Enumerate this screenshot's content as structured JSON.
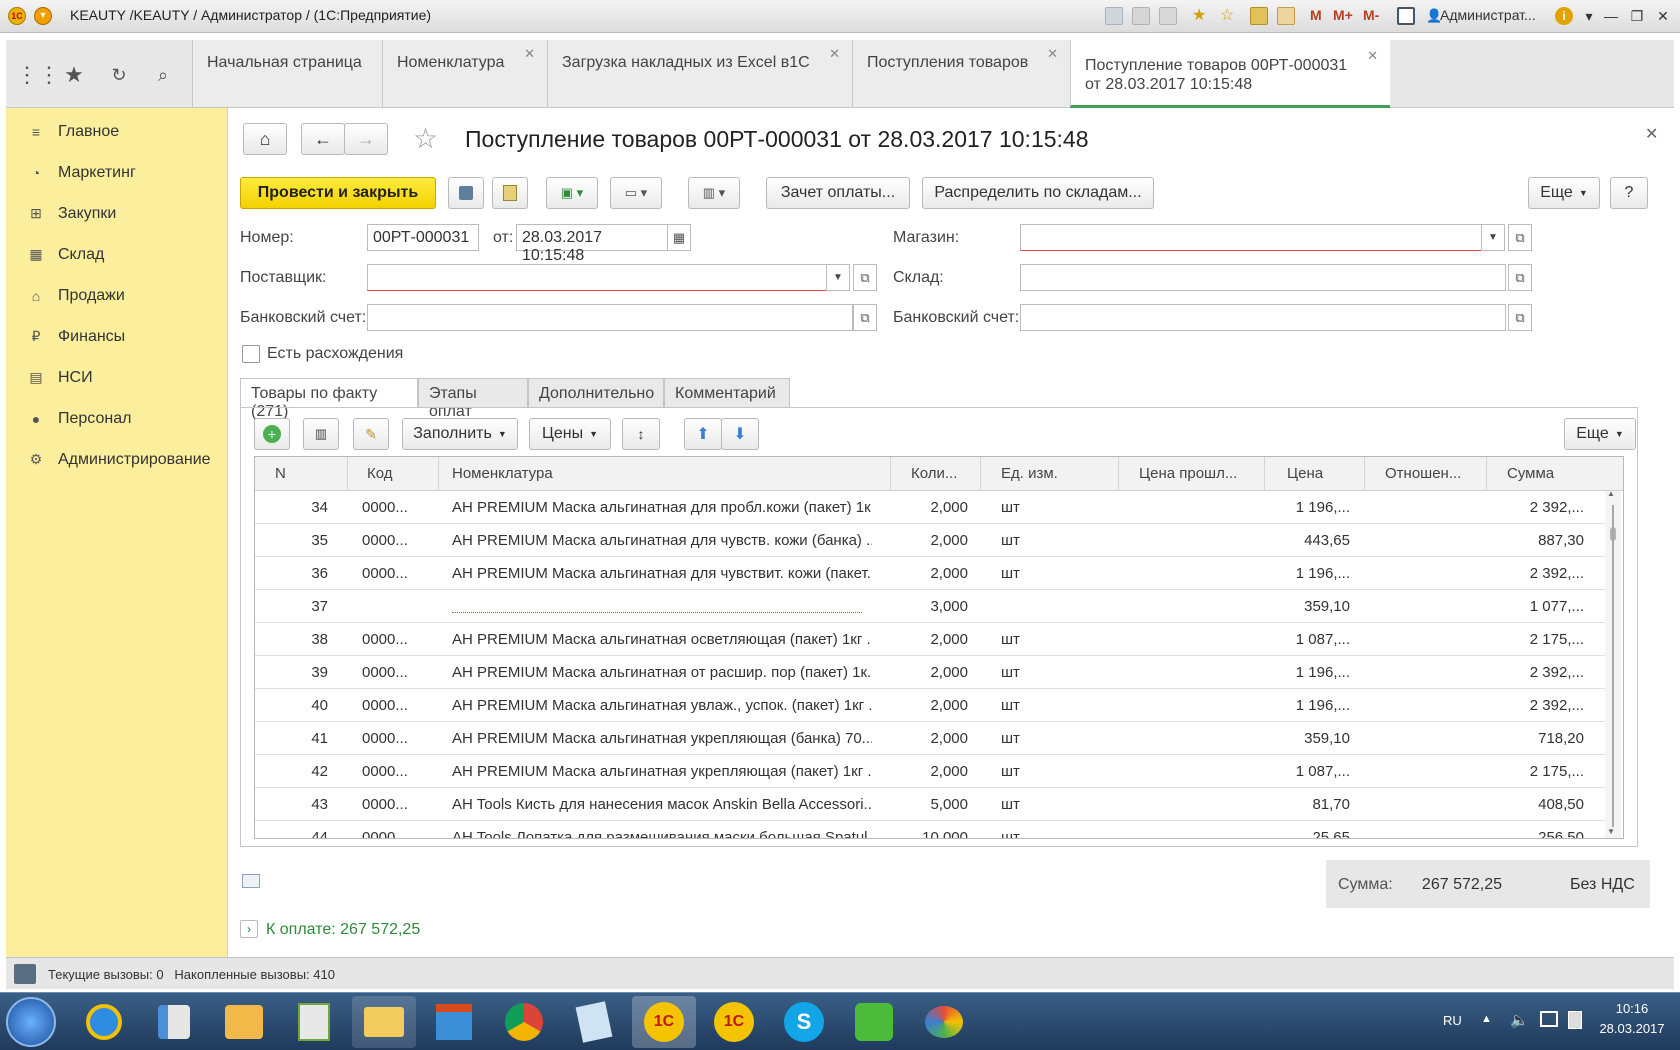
{
  "titlebar": {
    "title": "KEAUTY /KEAUTY / Администратор / (1С:Предприятие)",
    "user": "Администрат...",
    "logo_text": "1С",
    "toolbar_letters": [
      "M",
      "M+",
      "M-"
    ]
  },
  "tabs": [
    {
      "label": "Начальная страница",
      "closable": false
    },
    {
      "label": "Номенклатура",
      "closable": true
    },
    {
      "label": "Загрузка накладных из Excel в1С",
      "closable": true
    },
    {
      "label": "Поступления товаров",
      "closable": true
    },
    {
      "label": "Поступление товаров 00РТ-000031",
      "label2": "от 28.03.2017 10:15:48",
      "closable": true,
      "active": true
    }
  ],
  "sidebar": {
    "items": [
      {
        "label": "Главное",
        "icon": "menu-lines-icon"
      },
      {
        "label": "Маркетинг",
        "icon": "pie-chart-icon"
      },
      {
        "label": "Закупки",
        "icon": "cart-icon"
      },
      {
        "label": "Склад",
        "icon": "warehouse-icon"
      },
      {
        "label": "Продажи",
        "icon": "basket-icon"
      },
      {
        "label": "Финансы",
        "icon": "ruble-icon"
      },
      {
        "label": "НСИ",
        "icon": "book-icon"
      },
      {
        "label": "Персонал",
        "icon": "person-icon"
      },
      {
        "label": "Администрирование",
        "icon": "gear-icon"
      }
    ]
  },
  "document": {
    "title": "Поступление товаров 00РТ-000031 от 28.03.2017 10:15:48",
    "post_close_label": "Провести и закрыть",
    "offset_payment_label": "Зачет оплаты...",
    "distribute_label": "Распределить по складам...",
    "more_label": "Еще",
    "help_label": "?",
    "number_label": "Номер:",
    "number_value": "00РТ-000031",
    "date_label": "от:",
    "date_value": "28.03.2017 10:15:48",
    "store_label": "Магазин:",
    "store_value": "",
    "supplier_label": "Поставщик:",
    "supplier_value": "",
    "warehouse_label": "Склад:",
    "warehouse_value": "",
    "bank_account_label": "Банковский счет:",
    "bank_account_value": "",
    "bank_account2_label": "Банковский счет:",
    "bank_account2_value": "",
    "discrepancy_label": "Есть расхождения",
    "discrepancy_checked": false
  },
  "form_tabs": [
    "Товары по факту (271)",
    "Этапы оплат",
    "Дополнительно",
    "Комментарий"
  ],
  "table_toolbar": {
    "fill_label": "Заполнить",
    "prices_label": "Цены",
    "more_label": "Еще"
  },
  "table": {
    "columns": [
      "N",
      "Код",
      "Номенклатура",
      "Коли...",
      "Ед. изм.",
      "Цена прошл...",
      "Цена",
      "Отношен...",
      "Сумма"
    ],
    "rows": [
      {
        "n": "34",
        "code": "0000...",
        "name": "AH PREMIUM Маска альгинатная для пробл.кожи (пакет) 1к...",
        "qty": "2,000",
        "unit": "шт",
        "prev": "",
        "price": "1 196,...",
        "ratio": "",
        "sum": "2 392,..."
      },
      {
        "n": "35",
        "code": "0000...",
        "name": "AH PREMIUM Маска альгинатная для чувств. кожи (банка) ...",
        "qty": "2,000",
        "unit": "шт",
        "prev": "",
        "price": "443,65",
        "ratio": "",
        "sum": "887,30"
      },
      {
        "n": "36",
        "code": "0000...",
        "name": "AH PREMIUM Маска альгинатная для чувствит. кожи (пакет...",
        "qty": "2,000",
        "unit": "шт",
        "prev": "",
        "price": "1 196,...",
        "ratio": "",
        "sum": "2 392,..."
      },
      {
        "n": "37",
        "code": "",
        "name": "",
        "qty": "3,000",
        "unit": "",
        "prev": "",
        "price": "359,10",
        "ratio": "",
        "sum": "1 077,...",
        "error": true
      },
      {
        "n": "38",
        "code": "0000...",
        "name": "AH PREMIUM Маска альгинатная осветляющая (пакет) 1кг ...",
        "qty": "2,000",
        "unit": "шт",
        "prev": "",
        "price": "1 087,...",
        "ratio": "",
        "sum": "2 175,..."
      },
      {
        "n": "39",
        "code": "0000...",
        "name": "AH PREMIUM Маска альгинатная от расшир. пор (пакет) 1к...",
        "qty": "2,000",
        "unit": "шт",
        "prev": "",
        "price": "1 196,...",
        "ratio": "",
        "sum": "2 392,..."
      },
      {
        "n": "40",
        "code": "0000...",
        "name": "AH PREMIUM Маска альгинатная увлаж., успок. (пакет) 1кг ...",
        "qty": "2,000",
        "unit": "шт",
        "prev": "",
        "price": "1 196,...",
        "ratio": "",
        "sum": "2 392,..."
      },
      {
        "n": "41",
        "code": "0000...",
        "name": "AH PREMIUM Маска альгинатная укрепляющая (банка) 70...",
        "qty": "2,000",
        "unit": "шт",
        "prev": "",
        "price": "359,10",
        "ratio": "",
        "sum": "718,20"
      },
      {
        "n": "42",
        "code": "0000...",
        "name": "AH PREMIUM Маска альгинатная укрепляющая (пакет) 1кг ...",
        "qty": "2,000",
        "unit": "шт",
        "prev": "",
        "price": "1 087,...",
        "ratio": "",
        "sum": "2 175,..."
      },
      {
        "n": "43",
        "code": "0000...",
        "name": "AH Tools Кисть для нанесения масок Anskin Bella Accessori...",
        "qty": "5,000",
        "unit": "шт",
        "prev": "",
        "price": "81,70",
        "ratio": "",
        "sum": "408,50"
      },
      {
        "n": "44",
        "code": "0000...",
        "name": "AH Tools Лопатка для размешивания маски большая Spatul...",
        "qty": "10,000",
        "unit": "шт",
        "prev": "",
        "price": "25,65",
        "ratio": "",
        "sum": "256,50"
      }
    ]
  },
  "totals": {
    "sum_label": "Сумма:",
    "sum_value": "267 572,25",
    "vat_label": "Без НДС",
    "to_pay_label": "К оплате: 267 572,25"
  },
  "statusbar": {
    "text": "Текущие вызовы: 0   Накопленные вызовы: 410"
  },
  "taskbar": {
    "lang": "RU",
    "time": "10:16",
    "date": "28.03.2017"
  },
  "colors": {
    "sidebar_bg": "#fbee9d",
    "primary_button": "#f3d200",
    "active_tab_underline": "#3f9f56",
    "to_pay_text": "#2e8b3a"
  }
}
